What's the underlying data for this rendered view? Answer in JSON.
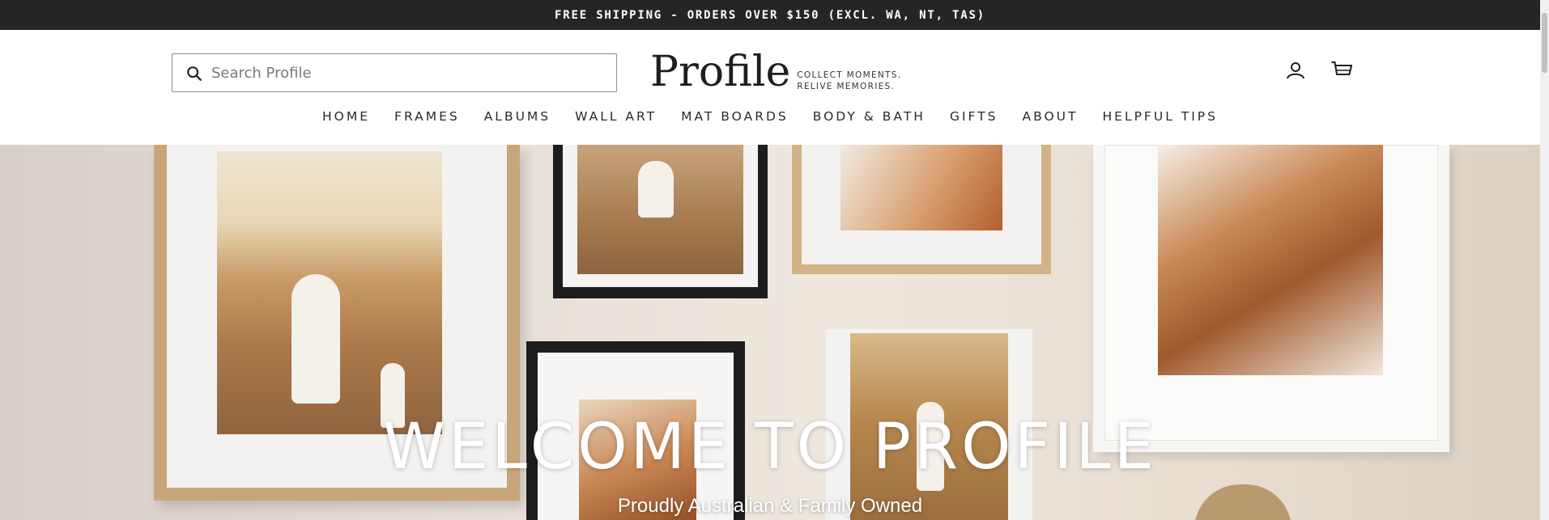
{
  "announcement": {
    "text": "FREE SHIPPING - ORDERS OVER $150 (EXCL. WA, NT, TAS)"
  },
  "search": {
    "placeholder": "Search Profile",
    "icon": "search-icon"
  },
  "logo": {
    "word": "Profile",
    "tagline_line1": "COLLECT MOMENTS.",
    "tagline_line2": "RELIVE MEMORIES."
  },
  "header_icons": {
    "account": "user-icon",
    "cart": "cart-icon"
  },
  "nav": {
    "items": [
      {
        "label": "HOME"
      },
      {
        "label": "FRAMES"
      },
      {
        "label": "ALBUMS"
      },
      {
        "label": "WALL ART"
      },
      {
        "label": "MAT BOARDS"
      },
      {
        "label": "BODY & BATH"
      },
      {
        "label": "GIFTS"
      },
      {
        "label": "ABOUT"
      },
      {
        "label": "HELPFUL TIPS"
      }
    ]
  },
  "hero": {
    "title": "WELCOME TO PROFILE",
    "subtitle": "Proudly Australian & Family Owned"
  },
  "colors": {
    "announcement_bg": "#242526",
    "text_dark": "#2b2b2b",
    "wheat": "#b98a5a",
    "oak": "#c8a57c",
    "frame_black": "#1c1c1c"
  }
}
